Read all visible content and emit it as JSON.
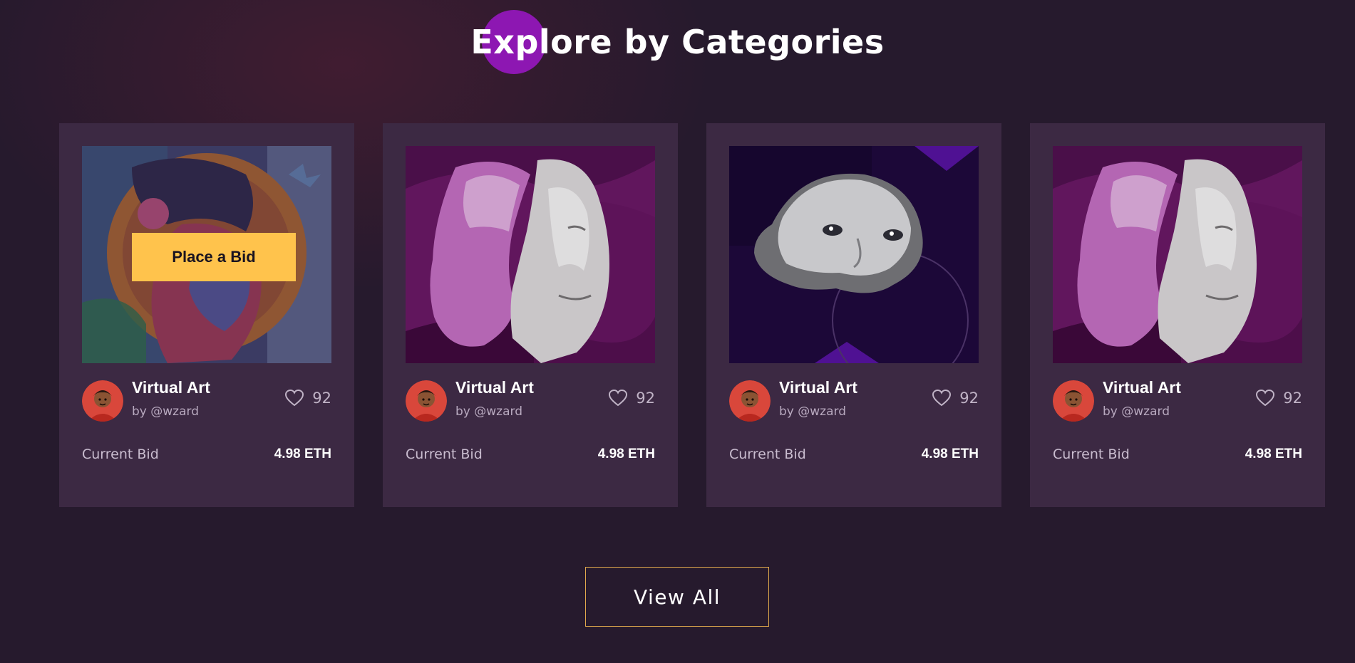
{
  "section": {
    "title": "Explore by Categories"
  },
  "cards": [
    {
      "title": "Virtual Art",
      "author": "by @wzard",
      "likes": "92",
      "bid_label": "Current Bid",
      "bid_value": "4.98 ETH",
      "image": "colorful-portrait-art",
      "hover_button": "Place a Bid"
    },
    {
      "title": "Virtual Art",
      "author": "by @wzard",
      "likes": "92",
      "bid_label": "Current Bid",
      "bid_value": "4.98 ETH",
      "image": "split-statue-head-purple"
    },
    {
      "title": "Virtual Art",
      "author": "by @wzard",
      "likes": "92",
      "bid_label": "Current Bid",
      "bid_value": "4.98 ETH",
      "image": "floating-statue-face-dark"
    },
    {
      "title": "Virtual Art",
      "author": "by @wzard",
      "likes": "92",
      "bid_label": "Current Bid",
      "bid_value": "4.98 ETH",
      "image": "split-statue-head-purple"
    }
  ],
  "view_all_label": "View All",
  "colors": {
    "background": "#261a2d",
    "card_background": "#3c2943",
    "accent_yellow": "#ffc34c",
    "title_dot": "#8d17b2",
    "view_all_border": "#e0a94c"
  }
}
